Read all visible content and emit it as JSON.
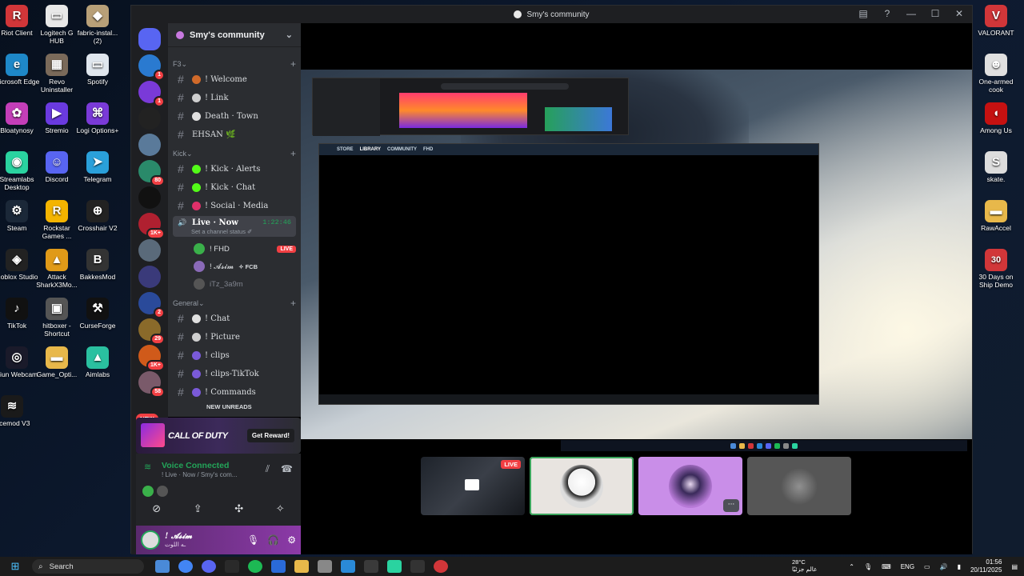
{
  "desktop": {
    "left_icons": [
      {
        "label": "Riot Client",
        "icon": "riot-client-icon",
        "color": "#d13639",
        "glyph": "R"
      },
      {
        "label": "Logitech G HUB",
        "icon": "logitech-ghub-icon",
        "color": "#e8e8e8",
        "glyph": "▭"
      },
      {
        "label": "fabric-instal... (2)",
        "icon": "jar-file-icon",
        "color": "#b8a078",
        "glyph": "◆"
      },
      {
        "label": "Microsoft Edge",
        "icon": "edge-icon",
        "color": "#1e88c8",
        "glyph": "e"
      },
      {
        "label": "Revo Uninstaller",
        "icon": "revo-uninstaller-icon",
        "color": "#7a6a5a",
        "glyph": "▦"
      },
      {
        "label": "Spotify",
        "icon": "spotify-file-icon",
        "color": "#dfe6ee",
        "glyph": "▭"
      },
      {
        "label": "Bloatynosy",
        "icon": "bloatynosy-icon",
        "color": "#c43eb8",
        "glyph": "✿"
      },
      {
        "label": "Stremio",
        "icon": "stremio-icon",
        "color": "#6a3ae0",
        "glyph": "▶"
      },
      {
        "label": "Logi Options+",
        "icon": "logi-options-icon",
        "color": "#7a3ad8",
        "glyph": "⌘"
      },
      {
        "label": "Streamlabs Desktop",
        "icon": "streamlabs-icon",
        "color": "#2ad3a0",
        "glyph": "◉"
      },
      {
        "label": "Discord",
        "icon": "discord-icon",
        "color": "#5865f2",
        "glyph": "☺"
      },
      {
        "label": "Telegram",
        "icon": "telegram-icon",
        "color": "#2aa0da",
        "glyph": "➤"
      },
      {
        "label": "Steam",
        "icon": "steam-icon",
        "color": "#1b2838",
        "glyph": "⚙"
      },
      {
        "label": "Rockstar Games ...",
        "icon": "rockstar-icon",
        "color": "#f4b400",
        "glyph": "R"
      },
      {
        "label": "Crosshair V2",
        "icon": "crosshair-icon",
        "color": "#222",
        "glyph": "⊕"
      },
      {
        "label": "Roblox Studio",
        "icon": "roblox-studio-icon",
        "color": "#222",
        "glyph": "◈"
      },
      {
        "label": "Attack SharkX3Mo...",
        "icon": "attack-shark-icon",
        "color": "#e09a18",
        "glyph": "▲"
      },
      {
        "label": "BakkesMod",
        "icon": "bakkesmod-icon",
        "color": "#333",
        "glyph": "B"
      },
      {
        "label": "TikTok",
        "icon": "tiktok-icon",
        "color": "#111",
        "glyph": "♪"
      },
      {
        "label": "hitboxer - Shortcut",
        "icon": "hitboxer-icon",
        "color": "#555",
        "glyph": "▣"
      },
      {
        "label": "CurseForge",
        "icon": "curseforge-icon",
        "color": "#111",
        "glyph": "⚒"
      },
      {
        "label": "Iriun Webcam",
        "icon": "iriun-webcam-icon",
        "color": "#1a1a2a",
        "glyph": "◎"
      },
      {
        "label": "Game_Opti...",
        "icon": "folder-icon",
        "color": "#e8b84a",
        "glyph": "▬"
      },
      {
        "label": "Aimlabs",
        "icon": "aimlabs-icon",
        "color": "#2ac0a0",
        "glyph": "▲"
      },
      {
        "label": "oicemod V3",
        "icon": "voicemod-icon",
        "color": "#1a1a1a",
        "glyph": "≋"
      }
    ],
    "right_icons": [
      {
        "label": "VALORANT",
        "icon": "valorant-icon",
        "color": "#d13639",
        "glyph": "V"
      },
      {
        "label": "One-armed cook",
        "icon": "one-armed-cook-icon",
        "color": "#e0e0e0",
        "glyph": "☻"
      },
      {
        "label": "Among Us",
        "icon": "among-us-icon",
        "color": "#c51111",
        "glyph": "◖"
      },
      {
        "label": "skate.",
        "icon": "skate-icon",
        "color": "#ddd",
        "glyph": "S"
      },
      {
        "label": "RawAccel",
        "icon": "folder-icon",
        "color": "#e8b84a",
        "glyph": "▬"
      },
      {
        "label": "30 Days on Ship Demo",
        "icon": "30-days-on-ship-icon",
        "color": "#d13639",
        "glyph": "30"
      }
    ],
    "partial_labels": [
      "jre",
      "W",
      "Re",
      "Ep L",
      "A",
      "A"
    ]
  },
  "window": {
    "title": "Smy's community",
    "controls": {
      "inbox": "inbox-icon",
      "help": "?",
      "minimize": "—",
      "maximize": "☐",
      "close": "✕"
    }
  },
  "guilds": [
    {
      "color": "#5865f2",
      "badge": ""
    },
    {
      "color": "#2a7ad0",
      "badge": "1"
    },
    {
      "color": "#7a3ad8",
      "badge": "1"
    },
    {
      "color": "#222",
      "badge": ""
    },
    {
      "color": "#5a7a9a",
      "badge": ""
    },
    {
      "color": "#2a8a6a",
      "badge": "80"
    },
    {
      "color": "#111",
      "badge": ""
    },
    {
      "color": "#b02030",
      "badge": "1K+"
    },
    {
      "color": "#5a6a7a",
      "badge": ""
    },
    {
      "color": "#3a3a7a",
      "badge": ""
    },
    {
      "color": "#2a4a9a",
      "badge": "2"
    },
    {
      "color": "#8a6a2a",
      "badge": "29"
    },
    {
      "color": "#d05a1a",
      "badge": "1K+"
    },
    {
      "color": "#7a5a6a",
      "badge": "58"
    }
  ],
  "new_pill": "NEW",
  "server": {
    "name": "Smy's community",
    "categories": [
      {
        "name": "F3",
        "channels": [
          {
            "name": "! Welcome",
            "icon_color": "#d06a2a",
            "icon": "chart-icon"
          },
          {
            "name": "! Link",
            "icon_color": "#cfcfcf",
            "icon": "link-icon"
          },
          {
            "name": "Death · Town",
            "icon_color": "#e0e0e0",
            "icon": "skull-icon"
          },
          {
            "name": "EHSAN 🌿",
            "icon_color": "",
            "icon": ""
          }
        ]
      },
      {
        "name": "Kick",
        "channels": [
          {
            "name": "! Kick · Alerts",
            "icon_color": "#53fc18",
            "icon": "kick-icon"
          },
          {
            "name": "! Kick · Chat",
            "icon_color": "#53fc18",
            "icon": "kick-icon"
          },
          {
            "name": "! Social · Media",
            "icon_color": "#e0306a",
            "icon": "social-icon"
          }
        ]
      },
      {
        "name": "General",
        "channels": [
          {
            "name": "! Chat",
            "icon_color": "#e0e0e0",
            "icon": "speech-icon"
          },
          {
            "name": "! Picture",
            "icon_color": "#cfcfcf",
            "icon": "picture-icon"
          },
          {
            "name": "! clips",
            "icon_color": "#7a5ad8",
            "icon": "clips-icon"
          },
          {
            "name": "! clips-TikTok",
            "icon_color": "#7a5ad8",
            "icon": "tiktok-icon"
          },
          {
            "name": "! Commands",
            "icon_color": "#7a5ad8",
            "icon": "commands-icon"
          }
        ]
      }
    ],
    "voice_channel": {
      "name": "Live · Now",
      "timer": "1:22:46",
      "status": "Set a channel status ✐",
      "users": [
        {
          "name": "! FHD",
          "live": "LIVE",
          "color": "#3ab04a"
        },
        {
          "name": "! 𝓐𝓼𝓲𝓶",
          "extra": "✧ FCB",
          "color": "#8a6ab8"
        },
        {
          "name": "iTz_3a9m",
          "color": "#555"
        }
      ]
    },
    "new_unreads": "NEW UNREADS"
  },
  "promo": {
    "title": "CALL OF DUTY",
    "button": "Get Reward!"
  },
  "voice_panel": {
    "status": "Voice Connected",
    "sub": "! Live · Now / Smy's com..."
  },
  "user": {
    "name": "! 𝓐𝓼𝓲𝓶",
    "sub": "ـه اللوت"
  },
  "stream": {
    "shared_menu": [
      "STORE",
      "LIBRARY",
      "COMMUNITY",
      "FHD"
    ],
    "tiles": [
      {
        "type": "screen",
        "live": "LIVE",
        "bg": "#2a2f38"
      },
      {
        "type": "avatar",
        "bg": "#e8e4e0",
        "av": "#ffffff",
        "border": "#3ba55c"
      },
      {
        "type": "avatar",
        "bg": "#c98ee8",
        "av": "#3a2a5a",
        "more": "···"
      },
      {
        "type": "avatar",
        "bg": "#666",
        "av": "#888"
      }
    ]
  },
  "taskbar": {
    "search": "Search",
    "weather_temp": "28°C",
    "weather_desc": "عالم جزئيًا",
    "lang": "ENG",
    "time": "01:56",
    "date": "20/11/2025",
    "apps": [
      "#4a8ad8",
      "#4285f4",
      "#5865f2",
      "#2a2a2a",
      "#1db954",
      "#2a6ad8",
      "#e8b84a",
      "#888",
      "#2a8ad8",
      "#3a3a3a",
      "#2ad3a0",
      "#333",
      "#d13639"
    ]
  }
}
